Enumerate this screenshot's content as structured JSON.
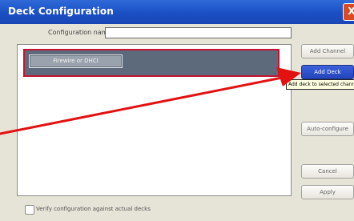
{
  "window": {
    "title": "Deck Configuration",
    "close_glyph": "X"
  },
  "config_name": {
    "label": "Configuration name:",
    "value": ""
  },
  "deck_list": [
    {
      "label": "Firewire or DHCI"
    }
  ],
  "buttons": {
    "add_channel": "Add Channel",
    "add_deck": "Add Deck",
    "auto_configure": "Auto-configure",
    "cancel": "Cancel",
    "apply": "Apply"
  },
  "tooltip": "Add deck to selected channel",
  "verify": {
    "label": "Verify configuration against actual decks",
    "checked": false
  },
  "annotation": {
    "arrow_color": "#e31212"
  },
  "colors": {
    "titlebar": "#1a4fc4",
    "selected_row_border": "#c21533",
    "dialog_bg": "#e6e3d7"
  }
}
